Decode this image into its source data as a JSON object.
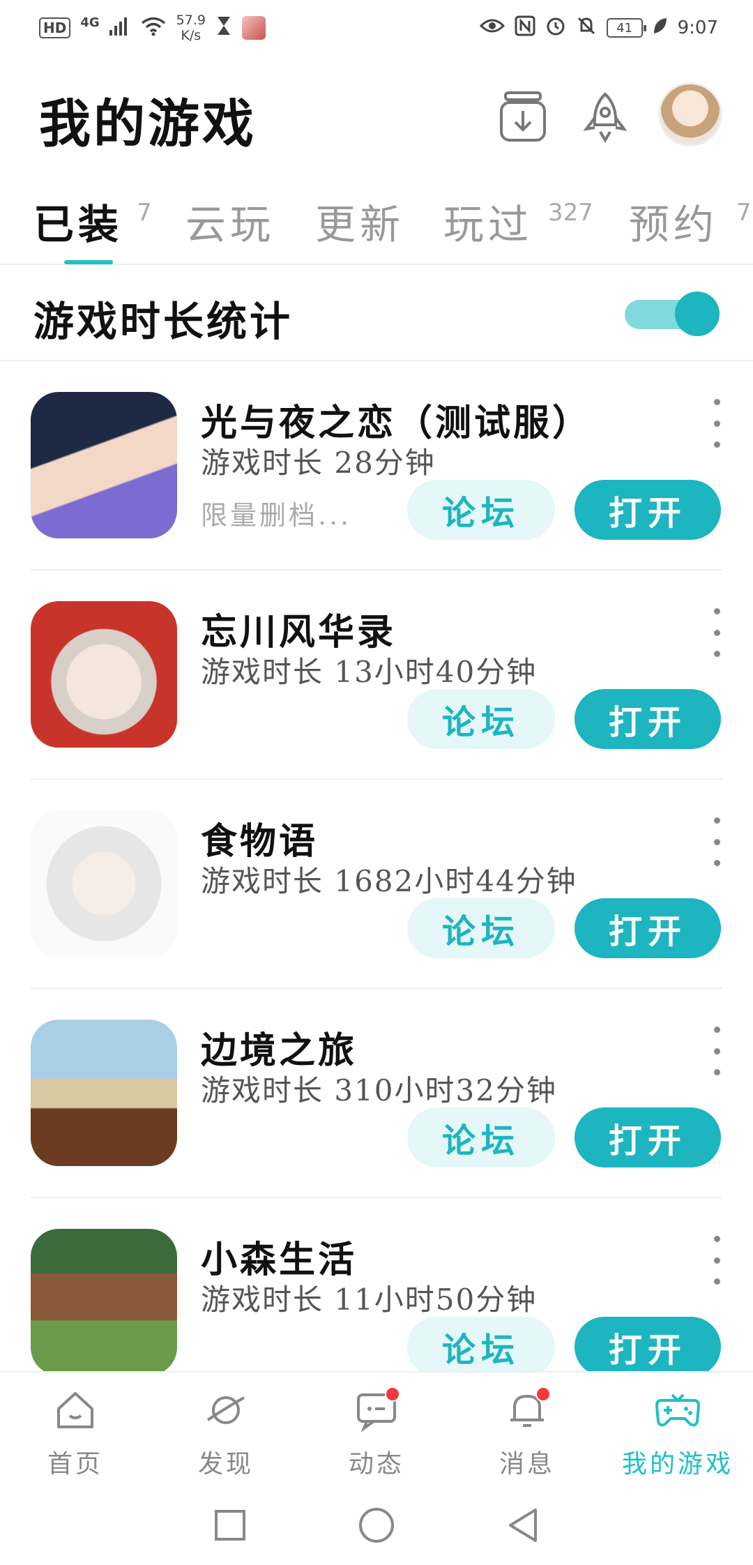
{
  "status_bar": {
    "hd": "HD",
    "network": "4G",
    "speed_value": "57.9",
    "speed_unit": "K/s",
    "battery": "41",
    "time": "9:07"
  },
  "header": {
    "title": "我的游戏"
  },
  "tabs": [
    {
      "label": "已装",
      "count": "7"
    },
    {
      "label": "云玩",
      "count": ""
    },
    {
      "label": "更新",
      "count": ""
    },
    {
      "label": "玩过",
      "count": "327"
    },
    {
      "label": "预约",
      "count": "7"
    }
  ],
  "stats": {
    "label": "游戏时长统计",
    "toggle_on": true
  },
  "games": [
    {
      "name": "光与夜之恋（测试服）",
      "time": "游戏时长 28分钟",
      "note": "限量删档...",
      "forum": "论坛",
      "open": "打开",
      "icon": "game-icon-light-and-night"
    },
    {
      "name": "忘川风华录",
      "time": "游戏时长 13小时40分钟",
      "note": "",
      "forum": "论坛",
      "open": "打开",
      "icon": "game-icon-wangchuan"
    },
    {
      "name": "食物语",
      "time": "游戏时长 1682小时44分钟",
      "note": "",
      "forum": "论坛",
      "open": "打开",
      "icon": "game-icon-food-fantasy"
    },
    {
      "name": "边境之旅",
      "time": "游戏时长 310小时32分钟",
      "note": "",
      "forum": "论坛",
      "open": "打开",
      "icon": "game-icon-frontier"
    },
    {
      "name": "小森生活",
      "time": "游戏时长 11小时50分钟",
      "note": "",
      "forum": "论坛",
      "open": "打开",
      "icon": "game-icon-ourplanet"
    }
  ],
  "bottom_nav": [
    {
      "label": "首页",
      "icon": "home-icon"
    },
    {
      "label": "发现",
      "icon": "planet-icon"
    },
    {
      "label": "动态",
      "icon": "chat-icon"
    },
    {
      "label": "消息",
      "icon": "bell-icon"
    },
    {
      "label": "我的游戏",
      "icon": "gamepad-icon"
    }
  ],
  "colors": {
    "accent": "#1cb5c0",
    "accent_light": "#e5f7f8",
    "badge": "#f0393c"
  }
}
